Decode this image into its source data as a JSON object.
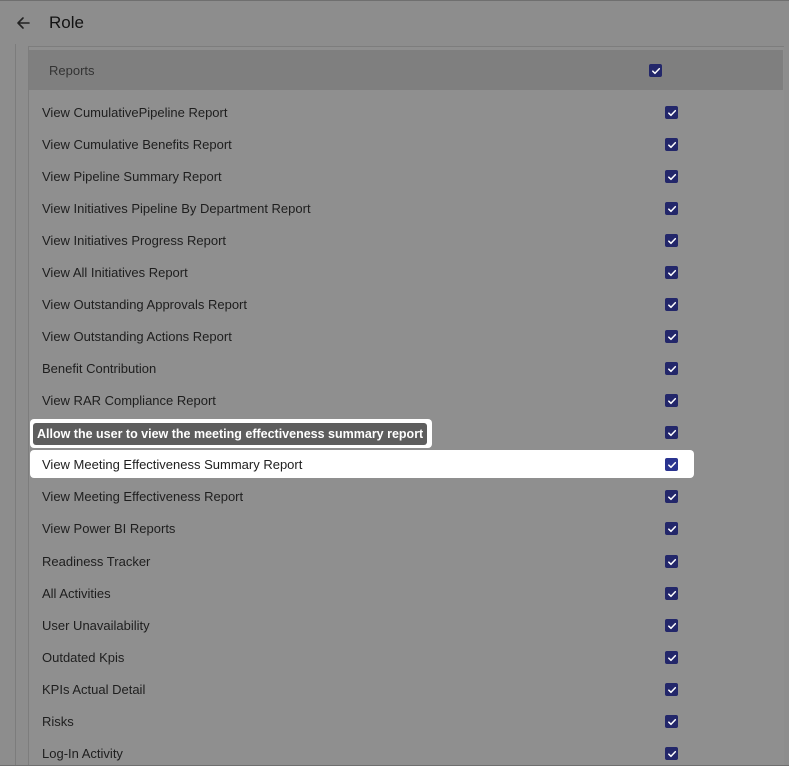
{
  "header": {
    "title": "Role"
  },
  "section": {
    "title": "Reports",
    "checked": true
  },
  "tooltip": {
    "text": "Allow the user to view the meeting effectiveness summary report"
  },
  "rows": [
    {
      "label": "View CumulativePipeline Report",
      "checked": true
    },
    {
      "label": "View Cumulative Benefits Report",
      "checked": true
    },
    {
      "label": "View Pipeline Summary Report",
      "checked": true
    },
    {
      "label": "View Initiatives Pipeline By Department Report",
      "checked": true
    },
    {
      "label": "View Initiatives Progress Report",
      "checked": true
    },
    {
      "label": "View All Initiatives Report",
      "checked": true
    },
    {
      "label": "View Outstanding Approvals Report",
      "checked": true
    },
    {
      "label": "View Outstanding Actions Report",
      "checked": true
    },
    {
      "label": "Benefit Contribution",
      "checked": true
    },
    {
      "label": "View RAR Compliance Report",
      "checked": true
    },
    {
      "label": "",
      "checked": true
    },
    {
      "label": "View Meeting Effectiveness Summary Report",
      "checked": true
    },
    {
      "label": "View Meeting Effectiveness Report",
      "checked": true
    },
    {
      "label": "View Power BI Reports",
      "checked": true
    },
    {
      "label": "Readiness Tracker",
      "checked": true
    },
    {
      "label": "All Activities",
      "checked": true
    },
    {
      "label": "User Unavailability",
      "checked": true
    },
    {
      "label": "Outdated Kpis",
      "checked": true
    },
    {
      "label": "KPIs Actual Detail",
      "checked": true
    },
    {
      "label": "Risks",
      "checked": true
    },
    {
      "label": "Log-In Activity",
      "checked": true
    }
  ]
}
